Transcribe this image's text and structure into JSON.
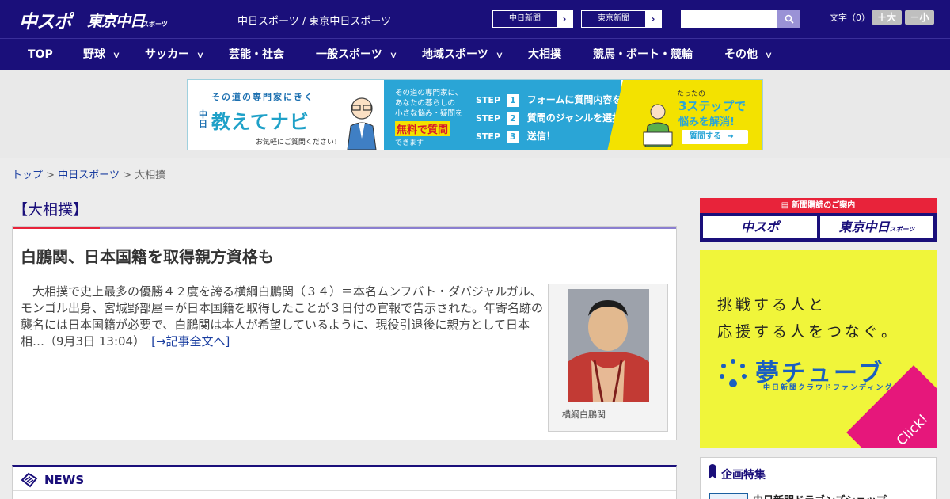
{
  "header": {
    "logo_chuspo": "中スポ",
    "logo_tokyo": "東京中日",
    "logo_tokyo_sub": "スポーツ",
    "site_links": "中日スポーツ / 東京中日スポーツ",
    "paper_buttons": [
      "中日新聞",
      "東京新聞"
    ],
    "search_placeholder": "",
    "font_size_label": "文字（0）",
    "font_bigger": "＋大",
    "font_smaller": "－小"
  },
  "nav": {
    "items": [
      {
        "label": "TOP",
        "dropdown": false
      },
      {
        "label": "野球",
        "dropdown": true
      },
      {
        "label": "サッカー",
        "dropdown": true
      },
      {
        "label": "芸能・社会",
        "dropdown": false
      },
      {
        "label": "一般スポーツ",
        "dropdown": true
      },
      {
        "label": "地域スポーツ",
        "dropdown": true
      },
      {
        "label": "大相撲",
        "dropdown": false
      },
      {
        "label": "競馬・ボート・競輪",
        "dropdown": false
      },
      {
        "label": "その他",
        "dropdown": true
      }
    ]
  },
  "ad_banner": {
    "left_tagline": "その道の専門家にきく",
    "left_brand_prefix": "中日",
    "left_brand": "教えてナビ",
    "left_note": "お気軽にご質問ください！",
    "mid_lines": [
      "その道の専門家に、",
      "あなたの暮らしの",
      "小さな悩み・疑問を"
    ],
    "mid_free": "無料で質問",
    "mid_tail": "できます",
    "steps": [
      {
        "n": "1",
        "text": "フォームに質問内容を入力"
      },
      {
        "n": "2",
        "text": "質問のジャンルを選択"
      },
      {
        "n": "3",
        "text": "送信！"
      }
    ],
    "step_word": "STEP",
    "right_top": "たったの",
    "right_main": "3ステップで",
    "right_sub": "悩みを解消!",
    "right_btn": "質問する"
  },
  "breadcrumb": {
    "top": "トップ",
    "sep": ">",
    "section": "中日スポーツ",
    "current": "大相撲"
  },
  "article": {
    "category": "【大相撲】",
    "title": "白鵬関、日本国籍を取得親方資格も",
    "body": "　大相撲で史上最多の優勝４２度を誇る横綱白鵬関（３４）＝本名ムンフバト・ダバジャルガル、モンゴル出身、宮城野部屋＝が日本国籍を取得したことが３日付の官報で告示された。年寄名跡の襲名には日本国籍が必要で、白鵬関は本人が希望しているように、現役引退後に親方として日本相…（9月3日 13:04）",
    "read_more": "[→記事全文へ]",
    "photo_caption": "横綱白鵬関"
  },
  "news": {
    "title": "NEWS"
  },
  "sidebar": {
    "subscription_head": "新聞購読のご案内",
    "sub_btn_1": "中スポ",
    "sub_btn_2": "東京中日",
    "sub_btn_2_suffix": "スポーツ",
    "yume_line_1": "挑戦する人と",
    "yume_line_2": "応援する人をつなぐ。",
    "yume_logo": "夢チューブ",
    "yume_sub": "中日新聞クラウドファンディング",
    "yume_click": "Click!",
    "feature_title": "企画特集",
    "feature_item": "中日新聞ドラゴンズショップ"
  },
  "colors": {
    "header_bg": "#1a0f7a",
    "accent_red": "#e8233a",
    "link": "#1a3ea0",
    "yume_bg": "#f0f53a",
    "yume_click": "#e6177b"
  }
}
